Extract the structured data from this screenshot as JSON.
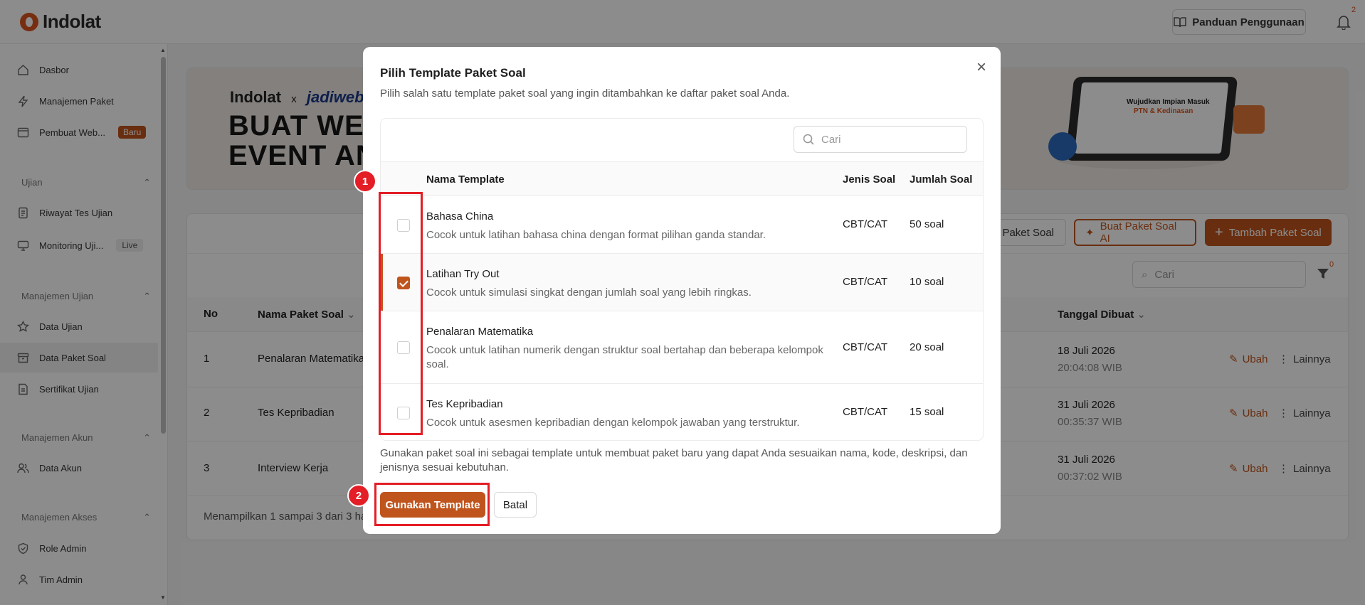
{
  "app": {
    "brand": "Indolat"
  },
  "header": {
    "guide_label": "Panduan Penggunaan",
    "notification_count": "2"
  },
  "sidebar": {
    "items": [
      {
        "label": "Dasbor"
      },
      {
        "label": "Manajemen Paket"
      },
      {
        "label": "Pembuat Web...",
        "badge": "Baru"
      }
    ],
    "sections": [
      {
        "title": "Ujian",
        "items": [
          {
            "label": "Riwayat Tes Ujian"
          },
          {
            "label": "Monitoring Uji...",
            "badge": "Live"
          }
        ]
      },
      {
        "title": "Manajemen Ujian",
        "items": [
          {
            "label": "Data Ujian"
          },
          {
            "label": "Data Paket Soal"
          },
          {
            "label": "Sertifikat Ujian"
          }
        ]
      },
      {
        "title": "Manajemen Akun",
        "items": [
          {
            "label": "Data Akun"
          }
        ]
      },
      {
        "title": "Manajemen Akses",
        "items": [
          {
            "label": "Role Admin"
          },
          {
            "label": "Tim Admin"
          }
        ]
      }
    ]
  },
  "banner": {
    "logo_left": "Indolat",
    "logo_x": "x",
    "logo_right": "jadiweb",
    "headline_1": "BUAT WEB",
    "headline_2": "EVENT AN",
    "device_title_1": "Wujudkan Impian Masuk",
    "device_title_2": "PTN & Kedinasan"
  },
  "background_page": {
    "buttons": {
      "template": "e Paket Soal",
      "ai": "Buat Paket Soal AI",
      "add": "Tambah Paket Soal"
    },
    "search_placeholder": "Cari",
    "filter_count": "0",
    "columns": {
      "no": "No",
      "name": "Nama Paket Soal",
      "date": "Tanggal Dibuat"
    },
    "rows": [
      {
        "no": "1",
        "name": "Penalaran Matematika",
        "date": "18 Juli 2026",
        "time": "20:04:08 WIB"
      },
      {
        "no": "2",
        "name": "Tes Kepribadian",
        "date": "31 Juli 2026",
        "time": "00:35:37 WIB"
      },
      {
        "no": "3",
        "name": "Interview Kerja",
        "date": "31 Juli 2026",
        "time": "00:37:02 WIB"
      }
    ],
    "action_edit": "Ubah",
    "action_more": "Lainnya",
    "footer": "Menampilkan 1 sampai 3 dari 3 ha"
  },
  "modal": {
    "title": "Pilih Template Paket Soal",
    "subtitle": "Pilih salah satu template paket soal yang ingin ditambahkan ke daftar paket soal Anda.",
    "search_placeholder": "Cari",
    "columns": {
      "name": "Nama Template",
      "type": "Jenis Soal",
      "count": "Jumlah Soal"
    },
    "rows": [
      {
        "name": "Bahasa China",
        "desc": "Cocok untuk latihan bahasa china dengan format pilihan ganda standar.",
        "type": "CBT/CAT",
        "count": "50 soal",
        "checked": false
      },
      {
        "name": "Latihan Try Out",
        "desc": "Cocok untuk simulasi singkat dengan jumlah soal yang lebih ringkas.",
        "type": "CBT/CAT",
        "count": "10 soal",
        "checked": true
      },
      {
        "name": "Penalaran Matematika",
        "desc": "Cocok untuk latihan numerik dengan struktur soal bertahap dan beberapa kelompok soal.",
        "type": "CBT/CAT",
        "count": "20 soal",
        "checked": false
      },
      {
        "name": "Tes Kepribadian",
        "desc": "Cocok untuk asesmen kepribadian dengan kelompok jawaban yang terstruktur.",
        "type": "CBT/CAT",
        "count": "15 soal",
        "checked": false
      }
    ],
    "note": "Gunakan paket soal ini sebagai template untuk membuat paket baru yang dapat Anda sesuaikan nama, kode, deskripsi, dan jenisnya sesuai kebutuhan.",
    "use_button": "Gunakan Template",
    "cancel_button": "Batal"
  },
  "annotations": [
    {
      "label": "1"
    },
    {
      "label": "2"
    }
  ],
  "colors": {
    "brand": "#c0541d",
    "annotation": "#e41e26"
  }
}
